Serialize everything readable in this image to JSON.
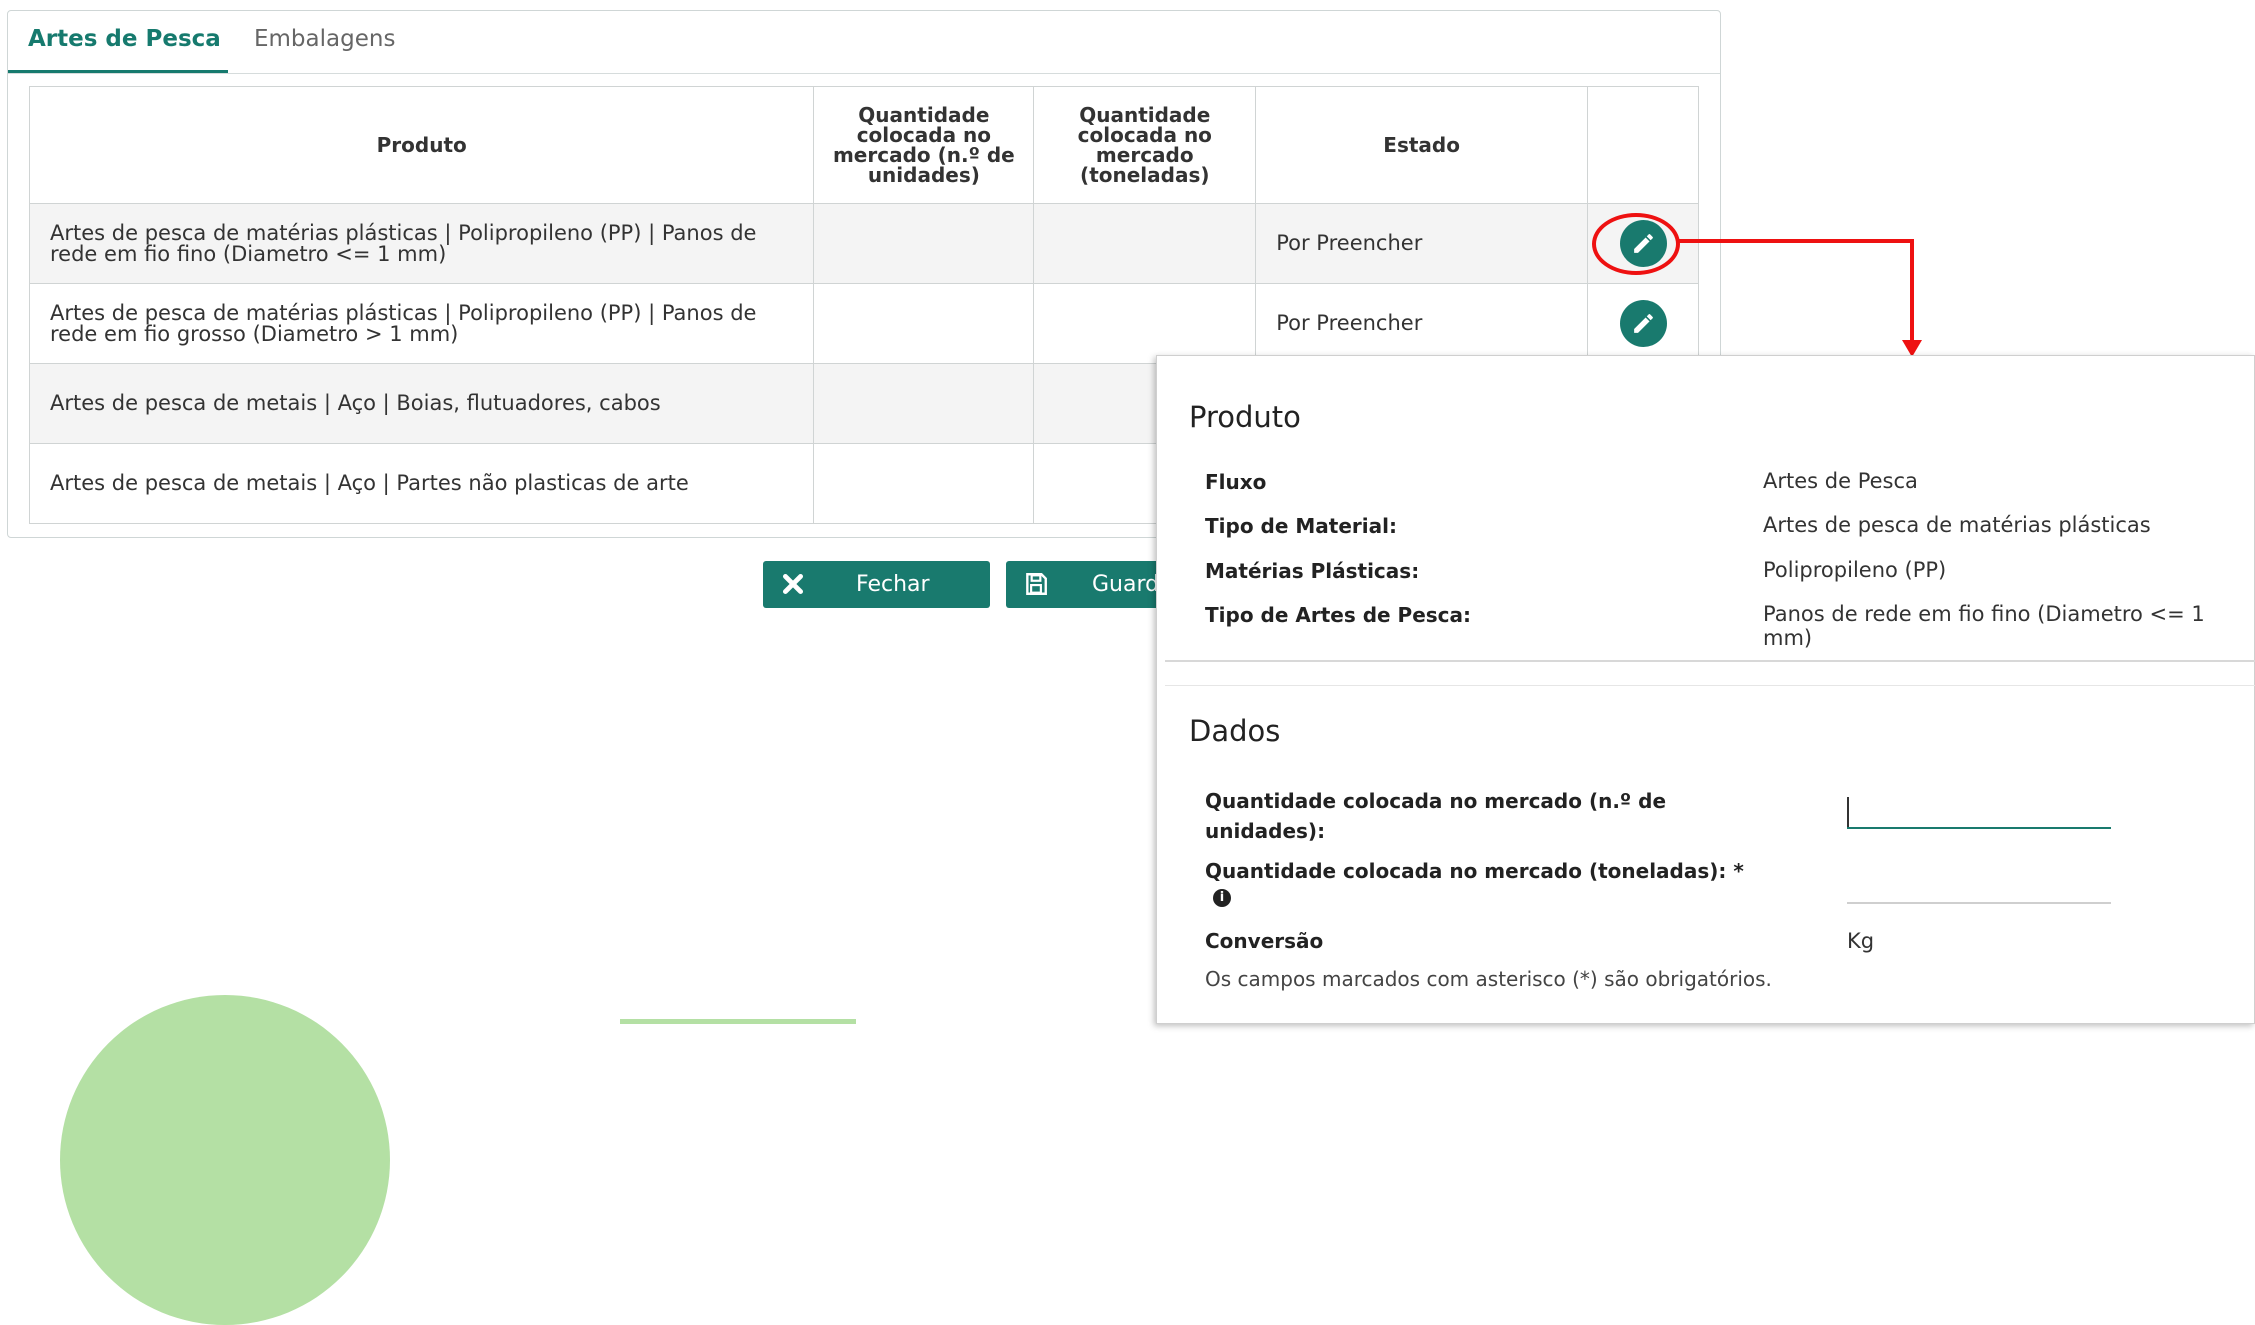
{
  "tabs": [
    {
      "label": "Artes de Pesca"
    },
    {
      "label": "Embalagens"
    }
  ],
  "table": {
    "headers": [
      "Produto",
      "Quantidade colocada no mercado (n.º de unidades)",
      "Quantidade colocada no mercado (toneladas)",
      "Estado"
    ],
    "rows": [
      {
        "produto_l1": "Artes de pesca de matérias plásticas | Polipropileno (PP) | Panos de",
        "produto_l2": "rede em fio fino (Diametro <= 1 mm)",
        "unidades": "",
        "toneladas": "",
        "estado": "Por Preencher"
      },
      {
        "produto_l1": "Artes de pesca de matérias plásticas | Polipropileno (PP) | Panos de",
        "produto_l2": "rede em fio grosso (Diametro > 1 mm)",
        "unidades": "",
        "toneladas": "",
        "estado": "Por Preencher"
      },
      {
        "produto_l1": "Artes de pesca de metais | Aço | Boias, flutuadores, cabos",
        "produto_l2": "",
        "unidades": "",
        "toneladas": "",
        "estado": ""
      },
      {
        "produto_l1": "Artes de pesca de metais | Aço | Partes não plasticas de arte",
        "produto_l2": "",
        "unidades": "",
        "toneladas": "",
        "estado": ""
      }
    ]
  },
  "buttons": {
    "close": "Fechar",
    "save": "Guardar"
  },
  "popup": {
    "produto_title": "Produto",
    "fields": [
      {
        "label": "Fluxo",
        "value": "Artes de Pesca"
      },
      {
        "label": "Tipo de Material:",
        "value": "Artes de pesca de matérias plásticas"
      },
      {
        "label": "Matérias Plásticas:",
        "value": "Polipropileno (PP)"
      },
      {
        "label": "Tipo de Artes de Pesca:",
        "value": "Panos de rede em fio fino (Diametro <= 1 mm)"
      }
    ],
    "dados_title": "Dados",
    "qty_units_label_l1": "Quantidade colocada no mercado (n.º de",
    "qty_units_label_l2": "unidades):",
    "qty_units_value": "",
    "qty_tons_label": "Quantidade colocada no mercado (toneladas): *",
    "qty_tons_value": "",
    "conversao_label": "Conversão",
    "conversao_value": "Kg",
    "required_note": "Os campos marcados com asterisco (*) são obrigatórios."
  },
  "colors": {
    "accent": "#197a6e",
    "highlight": "#ee1111",
    "decoration": "#b4e0a4"
  }
}
